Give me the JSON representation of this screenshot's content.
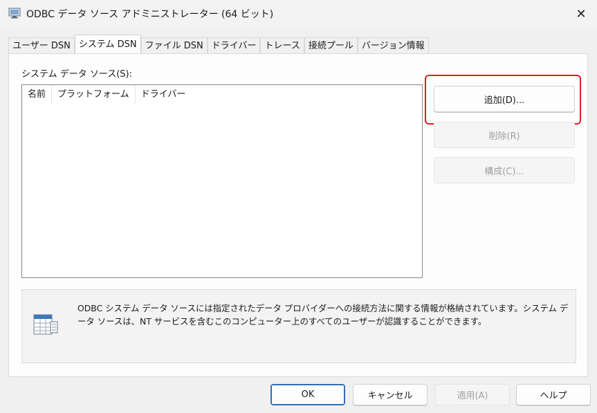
{
  "window": {
    "title": "ODBC データ ソース アドミニストレーター (64 ビット)",
    "close_symbol": "✕"
  },
  "tabs": [
    {
      "label": "ユーザー DSN",
      "active": false
    },
    {
      "label": "システム DSN",
      "active": true
    },
    {
      "label": "ファイル DSN",
      "active": false
    },
    {
      "label": "ドライバー",
      "active": false
    },
    {
      "label": "トレース",
      "active": false
    },
    {
      "label": "接続プール",
      "active": false
    },
    {
      "label": "バージョン情報",
      "active": false
    }
  ],
  "panel": {
    "list_label": "システム データ ソース(S):",
    "columns": [
      "名前",
      "プラットフォーム",
      "ドライバー"
    ],
    "rows": [],
    "buttons": {
      "add": "追加(D)...",
      "remove": "削除(R)",
      "configure": "構成(C)..."
    },
    "info_text": "ODBC システム データ ソースには指定されたデータ プロバイダーへの接続方法に関する情報が格納されています。システム データ ソースは、NT サービスを含むこのコンピューター上のすべてのユーザーが認識することができます。"
  },
  "footer": {
    "ok": "OK",
    "cancel": "キャンセル",
    "apply": "適用(A)",
    "help": "ヘルプ"
  },
  "colors": {
    "highlight": "#e81c24",
    "ok_border": "#2f6db5",
    "disabled_text": "#a0a0a0"
  }
}
